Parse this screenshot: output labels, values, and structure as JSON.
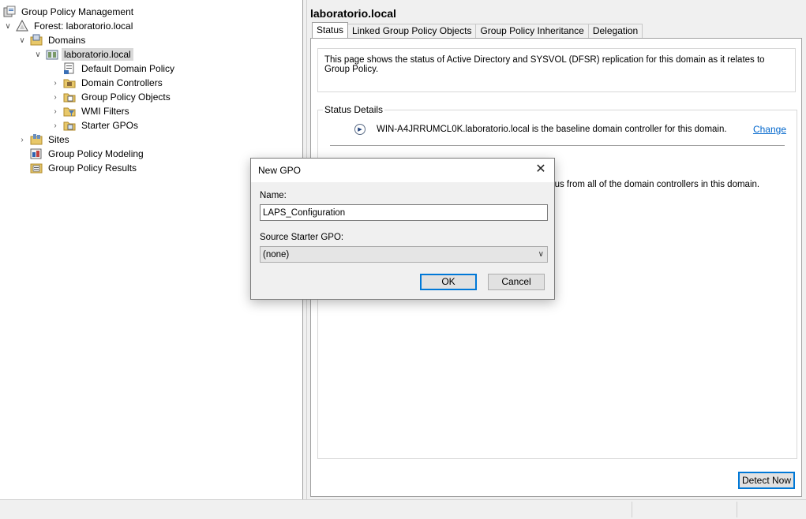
{
  "tree": {
    "root": "Group Policy Management",
    "forest": "Forest: laboratorio.local",
    "domains": "Domains",
    "domain": "laboratorio.local",
    "children": [
      "Default Domain Policy",
      "Domain Controllers",
      "Group Policy Objects",
      "WMI Filters",
      "Starter GPOs"
    ],
    "sites": "Sites",
    "modeling": "Group Policy Modeling",
    "results": "Group Policy Results"
  },
  "right": {
    "title": "laboratorio.local",
    "tabs": [
      "Status",
      "Linked Group Policy Objects",
      "Group Policy Inheritance",
      "Delegation"
    ],
    "info": "This page shows the status of Active Directory and SYSVOL (DFSR) replication for this domain as it relates to Group Policy.",
    "status_details_label": "Status Details",
    "baseline_text": "WIN-A4JRRUMCL0K.laboratorio.local is the baseline domain controller for this domain.",
    "change_link": "Change",
    "partial_text": "atus from all of the domain controllers in this domain.",
    "detect_button": "Detect Now"
  },
  "dialog": {
    "title": "New GPO",
    "name_label": "Name:",
    "name_value": "LAPS_Configuration",
    "source_label": "Source Starter GPO:",
    "source_value": "(none)",
    "ok": "OK",
    "cancel": "Cancel"
  },
  "icons": {
    "root": "gpmc-console-icon",
    "forest": "forest-triangle-icon",
    "domains": "domains-folder-icon",
    "domain": "domain-server-icon",
    "gpo": "gpo-script-icon",
    "folder": "folder-icon",
    "sites": "sites-icon",
    "modeling": "modeling-icon",
    "results": "results-icon"
  }
}
